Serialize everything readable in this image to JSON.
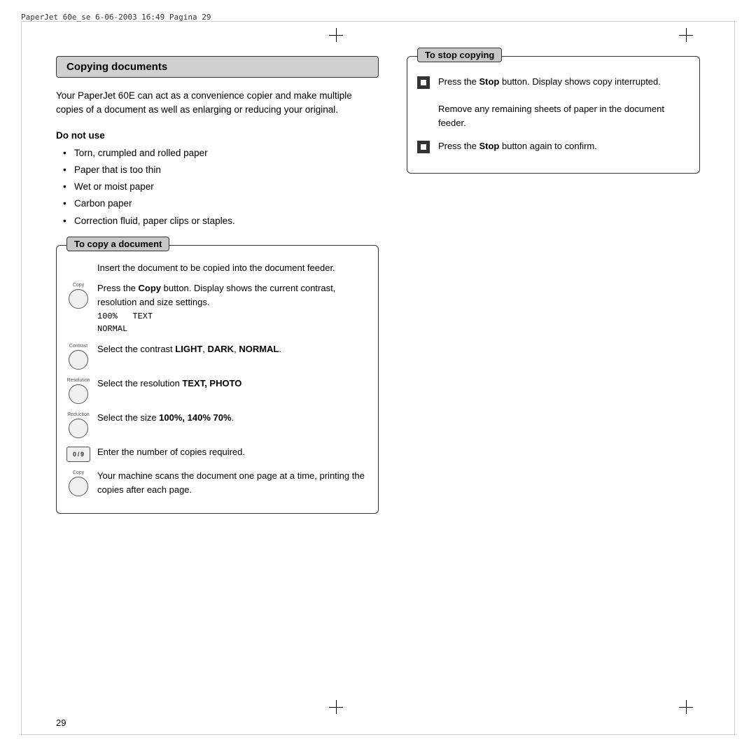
{
  "meta": {
    "header": "PaperJet 60e_se   6-06-2003   16:49   Pagina 29",
    "page_number": "29"
  },
  "left": {
    "section_title": "Copying documents",
    "intro": "Your PaperJet 60E can act as a convenience copier and make multiple copies of a document as well as enlarging or reducing your original.",
    "do_not_use_title": "Do not use",
    "bullets": [
      "Torn, crumpled and rolled paper",
      "Paper that is too thin",
      "Wet or moist paper",
      "Carbon paper",
      "Correction fluid, paper clips or staples."
    ],
    "copy_doc_box": {
      "title": "To copy a document",
      "steps": [
        {
          "icon_type": "none",
          "text": "Insert the document to be copied into the document feeder."
        },
        {
          "icon_type": "button",
          "icon_label": "Copy",
          "text_parts": [
            {
              "type": "text",
              "value": "Press the "
            },
            {
              "type": "bold",
              "value": "Copy"
            },
            {
              "type": "text",
              "value": " button. Display shows the current contrast, resolution and size settings."
            },
            {
              "type": "monospace",
              "value": "100%   TEXT\nNORMAL"
            }
          ]
        },
        {
          "icon_type": "button",
          "icon_label": "Contrast",
          "text_parts": [
            {
              "type": "text",
              "value": "Select the contrast "
            },
            {
              "type": "bold",
              "value": "LIGHT"
            },
            {
              "type": "text",
              "value": ", "
            },
            {
              "type": "bold",
              "value": "DARK"
            },
            {
              "type": "text",
              "value": ", "
            },
            {
              "type": "bold",
              "value": "NORMAL"
            },
            {
              "type": "text",
              "value": "."
            }
          ]
        },
        {
          "icon_type": "button",
          "icon_label": "Resolution",
          "text_parts": [
            {
              "type": "text",
              "value": "Select the resolution "
            },
            {
              "type": "bold",
              "value": "TEXT, PHOTO"
            }
          ]
        },
        {
          "icon_type": "button",
          "icon_label": "Reduction",
          "text_parts": [
            {
              "type": "text",
              "value": "Select the size "
            },
            {
              "type": "bold",
              "value": "100%, 140% 70%"
            },
            {
              "type": "text",
              "value": "."
            }
          ]
        },
        {
          "icon_type": "keypad",
          "icon_label": "0-9",
          "text_parts": [
            {
              "type": "text",
              "value": "Enter the number of copies required."
            }
          ]
        },
        {
          "icon_type": "button",
          "icon_label": "Copy",
          "text_parts": [
            {
              "type": "text",
              "value": "Your machine scans the document one page at a time, printing the copies after each page."
            }
          ]
        }
      ]
    }
  },
  "right": {
    "stop_copy_box": {
      "title": "To stop copying",
      "steps": [
        {
          "text_parts": [
            {
              "type": "text",
              "value": "Press the "
            },
            {
              "type": "bold",
              "value": "Stop"
            },
            {
              "type": "text",
              "value": " button. Display shows copy interrupted."
            },
            {
              "type": "break"
            },
            {
              "type": "text",
              "value": "\nRemove any remaining sheets of paper in the document feeder."
            }
          ]
        },
        {
          "text_parts": [
            {
              "type": "text",
              "value": "Press the "
            },
            {
              "type": "bold",
              "value": "Stop"
            },
            {
              "type": "text",
              "value": " button again to confirm."
            }
          ]
        }
      ]
    }
  }
}
